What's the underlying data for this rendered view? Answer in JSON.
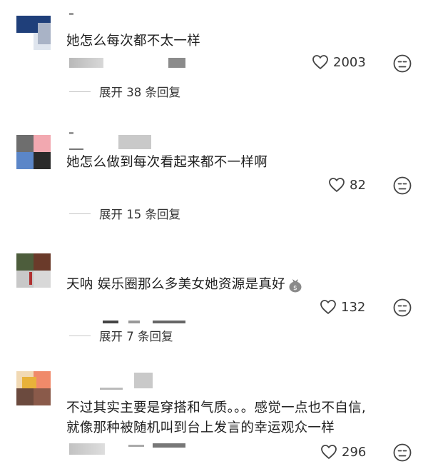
{
  "comments": [
    {
      "text": "她怎么每次都不太一样",
      "likes": "2003",
      "expand_label": "展开 38 条回复"
    },
    {
      "text": "她怎么做到每次看起来都不一样啊",
      "likes": "82",
      "expand_label": "展开 15 条回复"
    },
    {
      "text": "天呐 娱乐圈那么多美女她资源是真好",
      "emoji": "money-bag-emoji",
      "likes": "132",
      "expand_label": "展开 7 条回复"
    },
    {
      "text_line1": "不过其实主要是穿搭和气质。。。感觉一点也不自信,",
      "text_line2": "就像那种被随机叫到台上发言的幸运观众一样",
      "likes": "296"
    }
  ],
  "icons": {
    "like": "heart-outline-icon",
    "dislike": "unamused-face-icon"
  },
  "colors": {
    "text": "#1f1f1f",
    "meta": "#333333",
    "divider": "#c8c8c8"
  }
}
